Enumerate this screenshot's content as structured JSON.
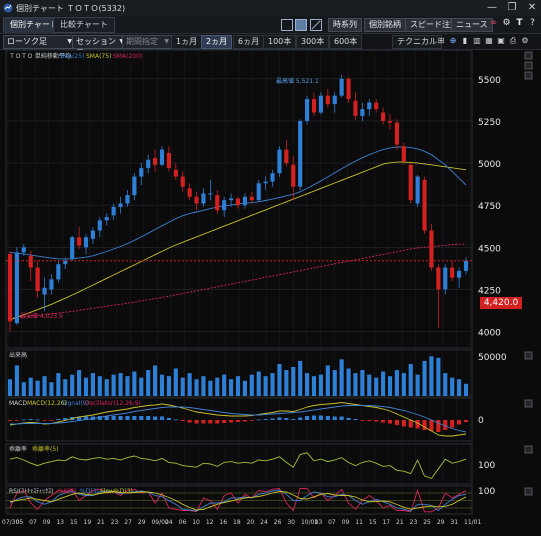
{
  "window": {
    "title": "個別チャート ＴＯＴＯ(5332)",
    "tabs": [
      "個別チャート",
      "比較チャート"
    ],
    "buttons": [
      "時系列",
      "個別銘柄",
      "スピード注文",
      "ニュース"
    ]
  },
  "toolbar": {
    "chart_type": "ローソク足",
    "session": "セッション足",
    "period_select": "期間指定",
    "periods": [
      "1ヵ月",
      "2ヵ月",
      "6ヵ月",
      "100本",
      "300本",
      "600本"
    ],
    "active_period": "2ヵ月",
    "technical_label": "テクニカル"
  },
  "price_panel": {
    "header_name": "ＴＯＴＯ 単純移動平均",
    "legend": [
      "SMA(25)",
      "SMA(75)",
      "SMA(200)"
    ],
    "high_label": "最高値 5,521.1",
    "low_label": "最安値 4,023.9",
    "current_price": "4,420.0",
    "y_ticks": [
      "5500",
      "5250",
      "5000",
      "4750",
      "4500",
      "4250",
      "4000"
    ]
  },
  "volume_panel": {
    "title": "出来高",
    "y_tick": "50000"
  },
  "macd_panel": {
    "title": "MACD",
    "legend": [
      "MACD(12,26)",
      "Signal(9)",
      "Oscillator(12,26,9)"
    ],
    "y_tick": "0"
  },
  "momentum_panel": {
    "title": "乖離率",
    "legend": [
      "乖離率(5)"
    ],
    "y_tick": "100"
  },
  "rsi_panel": {
    "title": "RSI(ｽﾄｷｬｽﾃｨｯｸｽ)",
    "legend": [
      "%K(5)",
      "%D(3)",
      "Slow%D(3)"
    ],
    "y_tick": "100"
  },
  "x_axis": [
    "07/30",
    "05",
    "07",
    "09",
    "13",
    "15",
    "19",
    "21",
    "23",
    "27",
    "29",
    "09/02",
    "04",
    "06",
    "10",
    "12",
    "16",
    "18",
    "20",
    "24",
    "26",
    "30",
    "10/01",
    "03",
    "07",
    "09",
    "11",
    "15",
    "17",
    "21",
    "23",
    "25",
    "29",
    "31",
    "11/01"
  ],
  "colors": {
    "up": "#2f7fd6",
    "down": "#d32020",
    "sma25": "#3f7fd0",
    "sma75": "#c8c22a",
    "sma200": "#d8245a",
    "bg": "#0b0b0c",
    "grid": "#262a30",
    "volume": "#2e7fd6"
  },
  "chart_data": {
    "type": "candlestick",
    "ylim": [
      3950,
      5600
    ],
    "candles": [
      [
        4460,
        4480,
        4000,
        4060
      ],
      [
        4050,
        4500,
        4040,
        4470
      ],
      [
        4470,
        4520,
        4450,
        4500
      ],
      [
        4450,
        4480,
        4300,
        4380
      ],
      [
        4380,
        4420,
        4200,
        4240
      ],
      [
        4220,
        4320,
        4120,
        4260
      ],
      [
        4250,
        4340,
        4220,
        4310
      ],
      [
        4310,
        4420,
        4290,
        4400
      ],
      [
        4400,
        4440,
        4370,
        4420
      ],
      [
        4430,
        4570,
        4420,
        4560
      ],
      [
        4560,
        4620,
        4490,
        4510
      ],
      [
        4500,
        4580,
        4460,
        4560
      ],
      [
        4550,
        4620,
        4520,
        4600
      ],
      [
        4600,
        4680,
        4560,
        4660
      ],
      [
        4660,
        4700,
        4630,
        4680
      ],
      [
        4690,
        4760,
        4660,
        4740
      ],
      [
        4740,
        4800,
        4700,
        4760
      ],
      [
        4760,
        4840,
        4740,
        4810
      ],
      [
        4810,
        4940,
        4780,
        4920
      ],
      [
        4920,
        5000,
        4870,
        4970
      ],
      [
        4970,
        5050,
        4940,
        5020
      ],
      [
        5030,
        5080,
        4950,
        4990
      ],
      [
        4990,
        5100,
        4980,
        5080
      ],
      [
        5060,
        5100,
        4950,
        4970
      ],
      [
        4960,
        5000,
        4900,
        4920
      ],
      [
        4920,
        4950,
        4830,
        4860
      ],
      [
        4850,
        4880,
        4780,
        4800
      ],
      [
        4800,
        4830,
        4720,
        4760
      ],
      [
        4760,
        4850,
        4740,
        4820
      ],
      [
        4820,
        4900,
        4780,
        4820
      ],
      [
        4810,
        4840,
        4700,
        4720
      ],
      [
        4720,
        4800,
        4680,
        4780
      ],
      [
        4780,
        4820,
        4740,
        4790
      ],
      [
        4790,
        4800,
        4730,
        4750
      ],
      [
        4750,
        4820,
        4730,
        4800
      ],
      [
        4800,
        4830,
        4760,
        4780
      ],
      [
        4780,
        4900,
        4770,
        4880
      ],
      [
        4880,
        4920,
        4840,
        4890
      ],
      [
        4890,
        4960,
        4860,
        4940
      ],
      [
        4940,
        5100,
        4920,
        5080
      ],
      [
        5080,
        5140,
        4980,
        5000
      ],
      [
        4990,
        5040,
        4780,
        4860
      ],
      [
        4860,
        5260,
        4840,
        5250
      ],
      [
        5250,
        5400,
        5230,
        5380
      ],
      [
        5380,
        5420,
        5280,
        5300
      ],
      [
        5300,
        5420,
        5290,
        5400
      ],
      [
        5400,
        5440,
        5330,
        5350
      ],
      [
        5350,
        5420,
        5300,
        5400
      ],
      [
        5400,
        5521,
        5390,
        5500
      ],
      [
        5500,
        5510,
        5360,
        5380
      ],
      [
        5370,
        5420,
        5260,
        5280
      ],
      [
        5280,
        5360,
        5250,
        5320
      ],
      [
        5320,
        5380,
        5280,
        5360
      ],
      [
        5360,
        5380,
        5300,
        5320
      ],
      [
        5300,
        5330,
        5230,
        5250
      ],
      [
        5250,
        5290,
        5200,
        5240
      ],
      [
        5240,
        5260,
        5080,
        5110
      ],
      [
        5100,
        5120,
        4990,
        5010
      ],
      [
        4990,
        5000,
        4760,
        4780
      ],
      [
        4760,
        4930,
        4740,
        4920
      ],
      [
        4900,
        4920,
        4580,
        4600
      ],
      [
        4600,
        4640,
        4360,
        4380
      ],
      [
        4380,
        4400,
        4024,
        4250
      ],
      [
        4250,
        4400,
        4220,
        4380
      ],
      [
        4380,
        4420,
        4300,
        4320
      ],
      [
        4320,
        4380,
        4260,
        4360
      ],
      [
        4360,
        4440,
        4340,
        4420
      ]
    ],
    "sma25": [
      4470,
      4465,
      4460,
      4455,
      4448,
      4442,
      4436,
      4432,
      4430,
      4432,
      4436,
      4442,
      4450,
      4462,
      4475,
      4490,
      4505,
      4522,
      4542,
      4562,
      4584,
      4606,
      4628,
      4650,
      4670,
      4688,
      4700,
      4710,
      4720,
      4730,
      4738,
      4745,
      4752,
      4758,
      4762,
      4765,
      4770,
      4778,
      4786,
      4796,
      4806,
      4815,
      4830,
      4850,
      4872,
      4895,
      4918,
      4942,
      4966,
      4990,
      5012,
      5032,
      5050,
      5066,
      5080,
      5090,
      5095,
      5096,
      5092,
      5084,
      5070,
      5050,
      5020,
      4990,
      4950,
      4910,
      4870
    ],
    "sma75": [
      4070,
      4085,
      4100,
      4115,
      4130,
      4145,
      4162,
      4180,
      4198,
      4217,
      4236,
      4256,
      4276,
      4296,
      4316,
      4336,
      4356,
      4376,
      4396,
      4416,
      4436,
      4456,
      4476,
      4496,
      4514,
      4530,
      4546,
      4562,
      4578,
      4594,
      4610,
      4626,
      4642,
      4658,
      4674,
      4690,
      4706,
      4722,
      4738,
      4754,
      4770,
      4786,
      4802,
      4818,
      4834,
      4850,
      4866,
      4882,
      4898,
      4914,
      4930,
      4946,
      4962,
      4978,
      4994,
      5002,
      5006,
      5006,
      5004,
      5000,
      4995,
      4990,
      4984,
      4978,
      4972,
      4966,
      4960
    ],
    "sma200": [
      4080,
      4084,
      4088,
      4092,
      4096,
      4100,
      4105,
      4110,
      4115,
      4120,
      4126,
      4132,
      4138,
      4144,
      4150,
      4156,
      4162,
      4168,
      4175,
      4182,
      4189,
      4196,
      4203,
      4210,
      4218,
      4226,
      4234,
      4242,
      4250,
      4258,
      4266,
      4274,
      4282,
      4290,
      4298,
      4306,
      4314,
      4322,
      4330,
      4338,
      4346,
      4354,
      4362,
      4370,
      4378,
      4386,
      4394,
      4402,
      4410,
      4418,
      4426,
      4434,
      4442,
      4450,
      4458,
      4466,
      4474,
      4482,
      4490,
      4496,
      4500,
      4504,
      4508,
      4512,
      4516,
      4518,
      4520
    ],
    "volume": [
      22,
      40,
      18,
      24,
      20,
      26,
      18,
      30,
      22,
      28,
      34,
      24,
      30,
      26,
      22,
      28,
      30,
      26,
      32,
      24,
      34,
      40,
      28,
      26,
      36,
      24,
      30,
      22,
      26,
      20,
      24,
      28,
      22,
      26,
      20,
      28,
      32,
      26,
      30,
      42,
      34,
      38,
      46,
      30,
      26,
      28,
      40,
      34,
      48,
      36,
      30,
      34,
      28,
      24,
      32,
      26,
      34,
      30,
      42,
      28,
      46,
      52,
      50,
      30,
      24,
      22,
      16
    ],
    "macd": [
      -10,
      -8,
      -6,
      -5,
      -6,
      -8,
      -7,
      -4,
      -1,
      3,
      6,
      8,
      10,
      13,
      16,
      18,
      20,
      22,
      25,
      27,
      29,
      30,
      32,
      30,
      27,
      24,
      20,
      16,
      14,
      12,
      10,
      9,
      8,
      8,
      8,
      9,
      11,
      13,
      15,
      18,
      18,
      17,
      21,
      26,
      29,
      31,
      32,
      33,
      35,
      33,
      31,
      29,
      27,
      25,
      22,
      18,
      12,
      6,
      0,
      -6,
      -14,
      -22,
      -30,
      -32,
      -32,
      -30,
      -28
    ],
    "signal": [
      -8,
      -8,
      -7,
      -7,
      -7,
      -7,
      -7,
      -6,
      -5,
      -3,
      -1,
      1,
      3,
      5,
      8,
      10,
      12,
      14,
      17,
      19,
      21,
      23,
      25,
      26,
      26,
      26,
      25,
      23,
      21,
      19,
      17,
      15,
      13,
      12,
      11,
      10,
      10,
      11,
      12,
      13,
      14,
      15,
      16,
      18,
      20,
      22,
      24,
      26,
      28,
      29,
      29,
      29,
      29,
      28,
      27,
      25,
      22,
      19,
      15,
      11,
      6,
      0,
      -6,
      -12,
      -17,
      -21,
      -24
    ],
    "deviation": [
      0.6,
      0.8,
      0.5,
      0.1,
      -0.2,
      0.1,
      0.3,
      0.5,
      0.4,
      0.9,
      0.6,
      0.5,
      0.7,
      0.8,
      0.6,
      0.7,
      0.5,
      0.8,
      1.0,
      0.7,
      0.6,
      0.4,
      0.7,
      0.2,
      0.1,
      -0.2,
      -0.3,
      -0.4,
      0.1,
      0.0,
      -0.3,
      0.2,
      0.3,
      0.1,
      0.2,
      0.1,
      0.5,
      0.4,
      0.6,
      0.9,
      0.2,
      -0.4,
      1.2,
      1.4,
      0.4,
      0.6,
      0.3,
      0.5,
      0.8,
      0.2,
      -0.2,
      0.2,
      0.4,
      0.1,
      -0.3,
      -0.2,
      -0.8,
      -0.9,
      -1.2,
      0.5,
      -1.5,
      -1.8,
      -0.6,
      0.6,
      0.1,
      0.3,
      0.6
    ],
    "rsi_k": [
      20,
      80,
      90,
      40,
      15,
      50,
      70,
      90,
      85,
      95,
      50,
      70,
      90,
      95,
      80,
      85,
      70,
      90,
      95,
      80,
      85,
      40,
      80,
      20,
      15,
      10,
      10,
      5,
      60,
      50,
      15,
      70,
      80,
      40,
      75,
      60,
      90,
      85,
      95,
      98,
      40,
      10,
      98,
      99,
      60,
      80,
      50,
      70,
      95,
      40,
      15,
      50,
      70,
      50,
      20,
      30,
      10,
      10,
      5,
      90,
      5,
      5,
      20,
      80,
      60,
      75,
      90
    ],
    "rsi_d": [
      40,
      55,
      65,
      65,
      45,
      35,
      45,
      70,
      80,
      88,
      75,
      70,
      70,
      85,
      88,
      85,
      78,
      82,
      85,
      88,
      83,
      70,
      65,
      50,
      35,
      15,
      12,
      8,
      25,
      40,
      40,
      45,
      60,
      60,
      65,
      60,
      75,
      80,
      88,
      92,
      75,
      50,
      50,
      70,
      85,
      80,
      65,
      65,
      75,
      70,
      50,
      35,
      45,
      55,
      45,
      35,
      20,
      15,
      8,
      35,
      35,
      30,
      10,
      35,
      55,
      70,
      75
    ],
    "rsi_slow": [
      45,
      50,
      55,
      60,
      55,
      50,
      45,
      55,
      65,
      75,
      80,
      75,
      72,
      78,
      82,
      86,
      82,
      80,
      82,
      84,
      84,
      80,
      72,
      62,
      50,
      35,
      22,
      12,
      15,
      25,
      35,
      42,
      48,
      55,
      60,
      63,
      66,
      72,
      80,
      86,
      84,
      72,
      58,
      56,
      65,
      75,
      78,
      72,
      70,
      70,
      64,
      52,
      45,
      46,
      48,
      45,
      34,
      23,
      15,
      20,
      25,
      28,
      25,
      27,
      35,
      50,
      65
    ]
  }
}
